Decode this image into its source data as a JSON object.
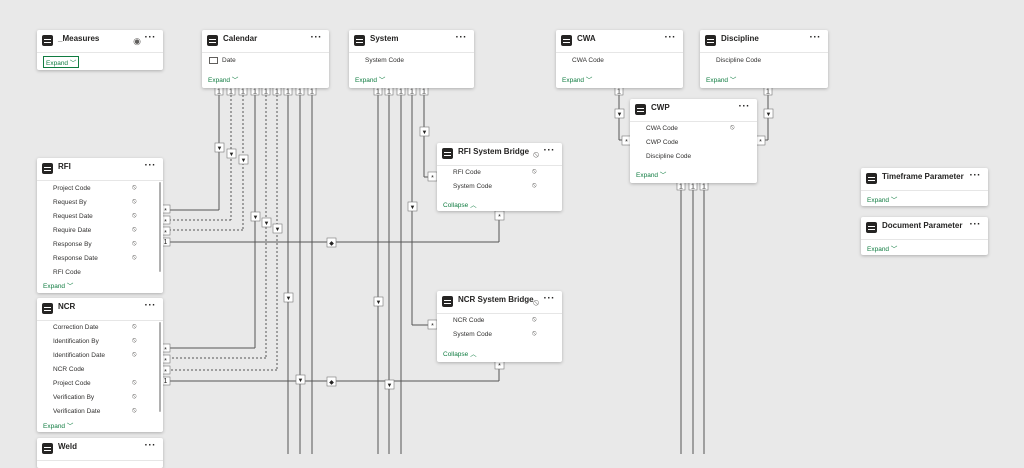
{
  "tables": {
    "measures": {
      "title": "_Measures",
      "expand": "Expand"
    },
    "calendar": {
      "title": "Calendar",
      "fields": [
        "Date"
      ],
      "expand": "Expand"
    },
    "system": {
      "title": "System",
      "fields": [
        "System Code"
      ],
      "expand": "Expand"
    },
    "cwa": {
      "title": "CWA",
      "fields": [
        "CWA Code"
      ],
      "expand": "Expand"
    },
    "discipline": {
      "title": "Discipline",
      "fields": [
        "Discipline Code"
      ],
      "expand": "Expand"
    },
    "cwp": {
      "title": "CWP",
      "fields": [
        "CWA Code",
        "CWP Code",
        "Discipline Code"
      ],
      "expand": "Expand"
    },
    "rfi": {
      "title": "RFI",
      "fields": [
        "Project Code",
        "Request By",
        "Request Date",
        "Require Date",
        "Response By",
        "Response Date",
        "RFI Code"
      ],
      "expand": "Expand"
    },
    "rfi_bridge": {
      "title": "RFI System Bridge",
      "fields": [
        "RFI Code",
        "System Code"
      ],
      "collapse": "Collapse"
    },
    "ncr": {
      "title": "NCR",
      "fields": [
        "Correction Date",
        "Identification By",
        "Identification Date",
        "NCR Code",
        "Project Code",
        "Verification By",
        "Verification Date"
      ],
      "expand": "Expand"
    },
    "ncr_bridge": {
      "title": "NCR System Bridge",
      "fields": [
        "NCR Code",
        "System Code"
      ],
      "collapse": "Collapse"
    },
    "weld": {
      "title": "Weld"
    },
    "timeframe": {
      "title": "Timeframe Parameter",
      "expand": "Expand"
    },
    "document": {
      "title": "Document Parameter",
      "expand": "Expand"
    }
  },
  "ui": {
    "more_label": "···",
    "one_label": "1",
    "many_label": "*",
    "chevron_down": "﹀",
    "chevron_up": "︿",
    "hidden_glyph": "⦸",
    "eye_glyph": "◉"
  }
}
